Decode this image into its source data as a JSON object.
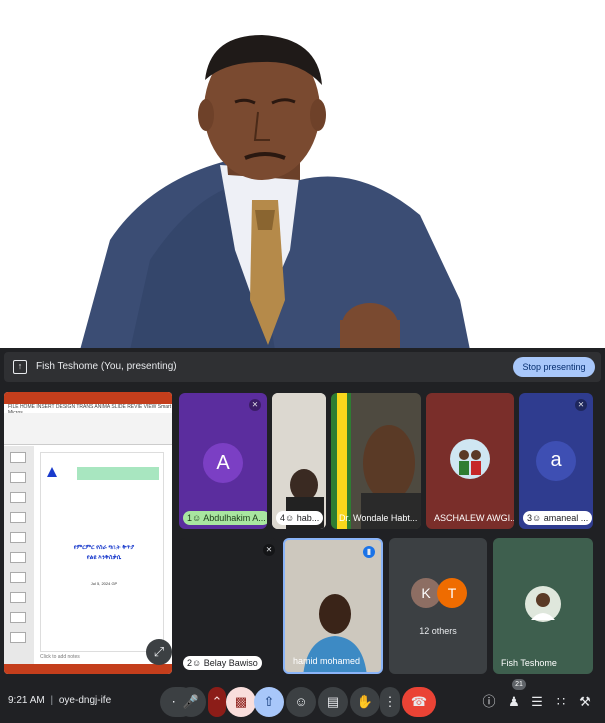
{
  "banner": {
    "presenter_text": "Fish Teshome (You, presenting)",
    "stop_label": "Stop presenting"
  },
  "slide": {
    "title_line1": "የምርምር የስራ ግቢት ቅጥያ",
    "title_line2": "የልዩ እንቅስቃሴ",
    "date": "Jul 5, 2024 GP",
    "notes_placeholder": "Click to add notes",
    "ribbon_tabs": "FILE  HOME  INSERT  DESIGN  TRANS  ANIMA  SLIDE  REVIE  VIEW  Smart  Micros"
  },
  "participants": {
    "tile1": {
      "initial": "A",
      "label": "1☺ Abdulhakim A...",
      "color": "#7b3fc4"
    },
    "tile2": {
      "label": "4☺ hab..."
    },
    "tile3": {
      "label": "Dr. Wondale Habt..."
    },
    "tile4": {
      "label": "ASCHALEW AWGI..."
    },
    "tile5": {
      "initial": "a",
      "label": "3☺ amaneal ...",
      "color": "#3e4fb3"
    },
    "tile6": {
      "label": "2☺ Belay Bawiso"
    },
    "tile7": {
      "label": "hamid mohamed"
    },
    "tile8": {
      "initial_k": "K",
      "initial_t": "T",
      "label": "12 others"
    },
    "tile9": {
      "label": "Fish Teshome"
    }
  },
  "bottombar": {
    "time": "9:21 AM",
    "separator": "|",
    "meeting_code": "oye-dngj-ife",
    "participant_count": "21"
  },
  "colors": {
    "meet_bg": "#202124",
    "stop_button": "#a8c7fa",
    "end_call": "#ea4335"
  }
}
